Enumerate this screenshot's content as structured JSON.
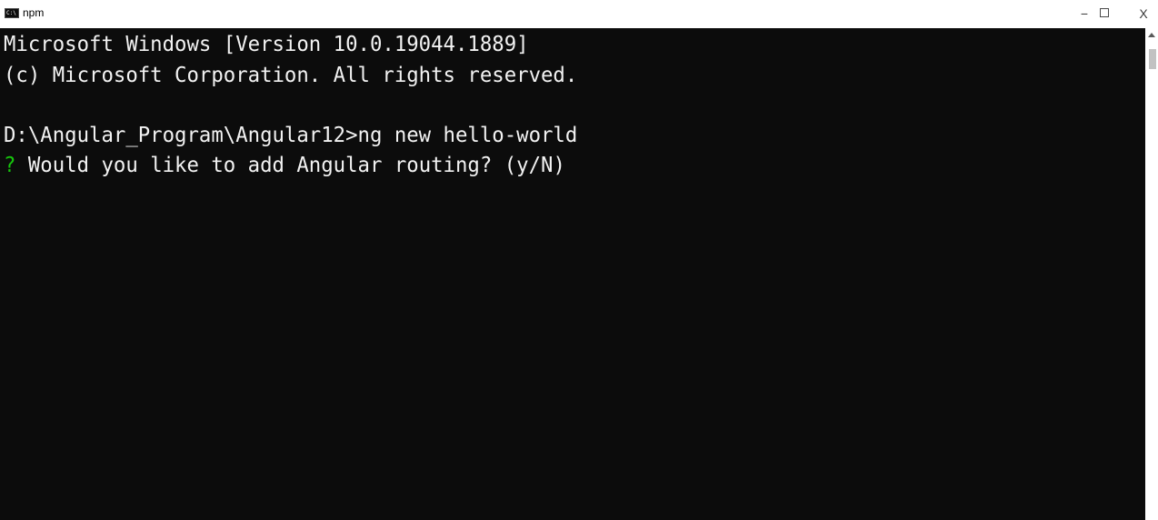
{
  "window": {
    "title": "npm",
    "icon": "console-icon"
  },
  "controls": {
    "minimize": "−",
    "maximize": "",
    "close": "X"
  },
  "console": {
    "line1": "Microsoft Windows [Version 10.0.19044.1889]",
    "line2": "(c) Microsoft Corporation. All rights reserved.",
    "line3": "D:\\Angular_Program\\Angular12>ng new hello-world",
    "prompt_mark": "?",
    "line4_text": " Would you like to add Angular routing? (y/N)"
  },
  "colors": {
    "background": "#0c0c0c",
    "foreground": "#f2f2f2",
    "prompt_mark": "#16c60c"
  }
}
